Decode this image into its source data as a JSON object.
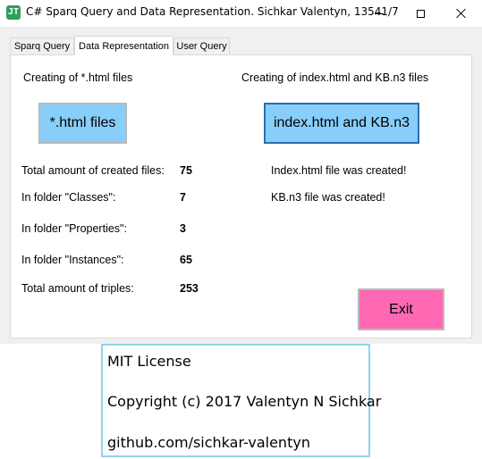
{
  "window": {
    "title": "C# Sparq Query and Data Representation. Sichkar Valentyn, 13541/7",
    "icon": "app-logo-icon"
  },
  "tabs": [
    {
      "label": "Sparq Query",
      "selected": false
    },
    {
      "label": "Data Representation",
      "selected": true
    },
    {
      "label": "User Query",
      "selected": false
    }
  ],
  "panel": {
    "left_heading": "Creating of *.html files",
    "right_heading": "Creating of index.html and KB.n3 files",
    "html_button_label": "*.html files",
    "index_button_label": "index.html and KB.n3",
    "exit_button_label": "Exit",
    "stats": [
      {
        "label": "Total amount of created files:",
        "value": "75"
      },
      {
        "label": "In folder \"Classes\":",
        "value": "7"
      },
      {
        "label": "In folder \"Properties\":",
        "value": "3"
      },
      {
        "label": "In folder \"Instances\":",
        "value": "65"
      },
      {
        "label": "Total amount of triples:",
        "value": "253"
      }
    ],
    "messages": [
      "Index.html file was created!",
      "KB.n3 file was created!"
    ]
  },
  "license": {
    "line1": "MIT License",
    "line2": "Copyright (c) 2017 Valentyn N Sichkar",
    "line3": "github.com/sichkar-valentyn"
  },
  "colors": {
    "button_blue": "#87cefa",
    "exit_pink": "#ff69b4",
    "license_border": "#8fd3ee"
  }
}
